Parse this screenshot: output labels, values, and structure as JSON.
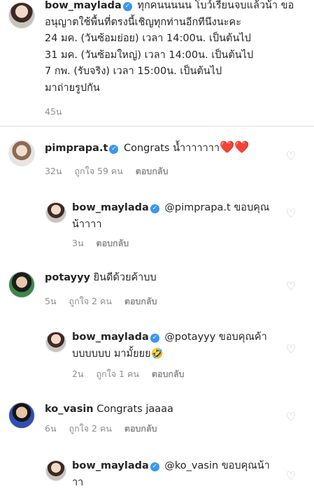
{
  "caption": {
    "username": "bow_maylada",
    "text": "ทุกคนนนนน โบว์เรียนจบแล้วน้า ขออนุญาตใช้พื้นที่ตรงนี้เชิญทุกท่านอีกทีนึงนะคะ\n24 มค. (วันซ้อมย่อย) เวลา 14:00น. เป็นต้นไป\n31 มค. (วันซ้อมใหญ่) เวลา 14:00น. เป็นต้นไป\n7 กพ. (รับจริง) เวลา 15:00น. เป็นต้นไป\nมาถ่ายรูปกัน",
    "time": "45น"
  },
  "comments": [
    {
      "username": "pimprapa.t",
      "text": "Congrats น้ำาาาาาา",
      "emoji": "❤️❤️",
      "time": "32น",
      "likes": "ถูกใจ 59 คน",
      "reply": "ตอบกลับ"
    },
    {
      "username": "bow_maylada",
      "text": "@pimprapa.t ขอบคุณน้าาาา",
      "time": "3น",
      "reply": "ตอบกลับ"
    },
    {
      "username": "potayyy",
      "text": "ยินดีด้วยค้าบบ",
      "time": "5น",
      "likes": "ถูกใจ 2 คน",
      "reply": "ตอบกลับ"
    },
    {
      "username": "bow_maylada",
      "text": "@potayyy ขอบคุณค้าบบบบบบ มามั้ยยย🤣",
      "time": "2น",
      "likes": "ถูกใจ 1 คน",
      "reply": "ตอบกลับ"
    },
    {
      "username": "ko_vasin",
      "text": "Congrats jaaaa",
      "time": "6น",
      "likes": "ถูกใจ 2 คน",
      "reply": "ตอบกลับ"
    },
    {
      "username": "bow_maylada",
      "text": "@ko_vasin ขอบคุณน้าาา"
    }
  ],
  "icons": {
    "verified": "verified-badge-icon",
    "like": "heart-outline-icon"
  },
  "colors": {
    "verified": "#3897f0",
    "meta": "#8e8e8e",
    "divider": "#dbdbdb"
  }
}
